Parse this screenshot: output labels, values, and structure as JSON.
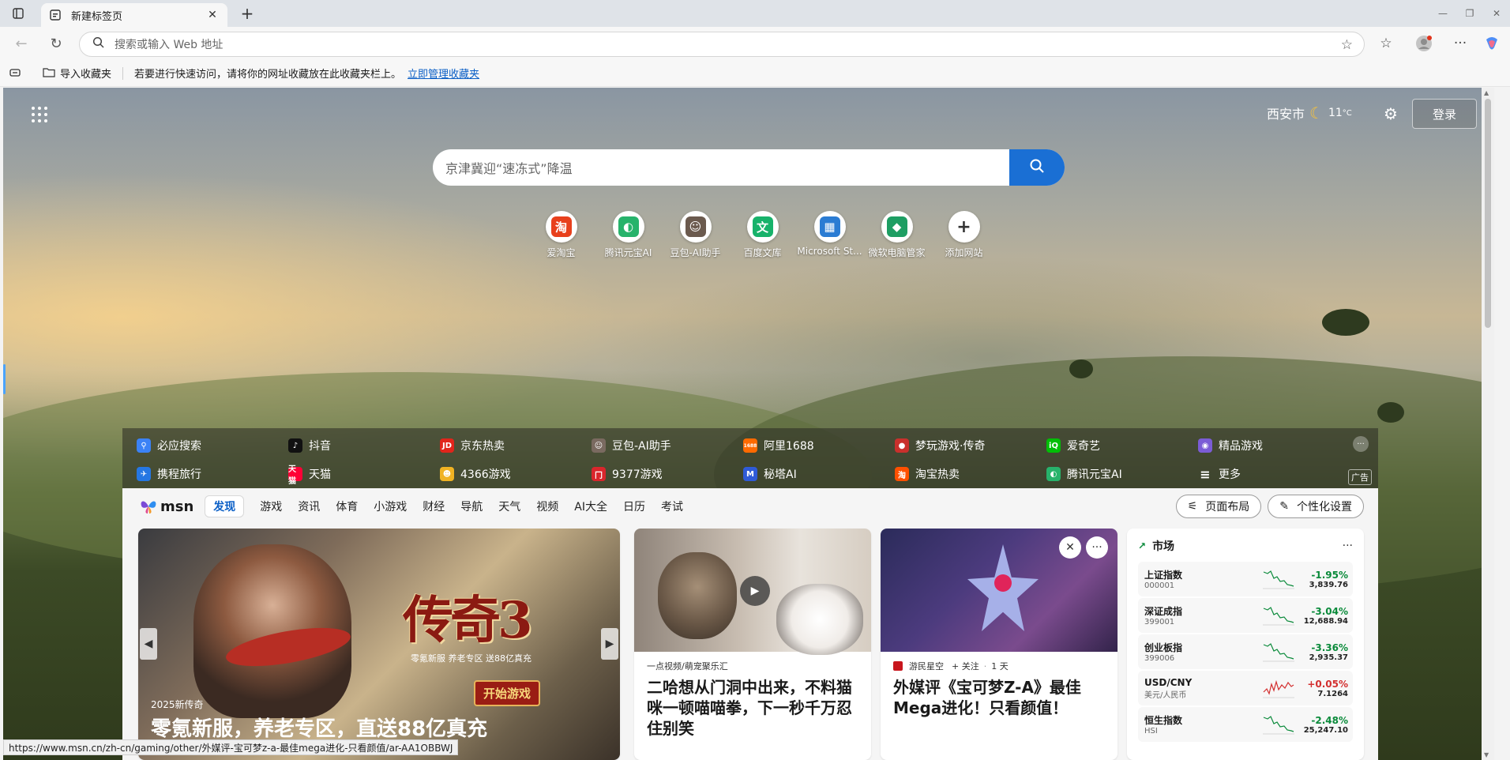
{
  "browser": {
    "tab_title": "新建标签页",
    "address_placeholder": "搜索或输入 Web 地址"
  },
  "favorites_bar": {
    "import_label": "导入收藏夹",
    "hint": "若要进行快速访问，请将你的网址收藏放在此收藏夹栏上。",
    "manage_link": "立即管理收藏夹"
  },
  "header": {
    "city": "西安市",
    "temperature": "11",
    "temp_unit": "°C",
    "login_label": "登录"
  },
  "search": {
    "placeholder": "京津冀迎“速冻式”降温"
  },
  "tiles": [
    {
      "label": "爱淘宝",
      "icon": "taobao-icon",
      "glyph": "淘",
      "color": "#e8401c"
    },
    {
      "label": "腾讯元宝AI",
      "icon": "yuanbao-icon",
      "glyph": "◐",
      "color": "#27b36b"
    },
    {
      "label": "豆包-AI助手",
      "icon": "doubao-icon",
      "glyph": "☺",
      "color": "#6b5a4e"
    },
    {
      "label": "百度文库",
      "icon": "wenku-icon",
      "glyph": "文",
      "color": "#17b26a"
    },
    {
      "label": "Microsoft St...",
      "icon": "microsoft-store-icon",
      "glyph": "▦",
      "color": "#2b7cd3"
    },
    {
      "label": "微软电脑管家",
      "icon": "pc-manager-icon",
      "glyph": "◆",
      "color": "#1e9e63"
    },
    {
      "label": "添加网站",
      "icon": "add-site-icon",
      "glyph": "+",
      "color": "#ffffff"
    }
  ],
  "quick_links": {
    "row1": [
      {
        "label": "必应搜索",
        "icon": "bing-search-icon",
        "glyph": "⚲",
        "color": "#3b82f6"
      },
      {
        "label": "抖音",
        "icon": "douyin-icon",
        "glyph": "♪",
        "color": "#111111"
      },
      {
        "label": "京东热卖",
        "icon": "jd-icon",
        "glyph": "JD",
        "color": "#e1251b"
      },
      {
        "label": "豆包-AI助手",
        "icon": "doubao-icon",
        "glyph": "☺",
        "color": "#7a6a60"
      },
      {
        "label": "阿里1688",
        "icon": "ali1688-icon",
        "glyph": "1688",
        "color": "#ff6a00"
      },
      {
        "label": "梦玩游戏·传奇",
        "icon": "mengwan-icon",
        "glyph": "●",
        "color": "#c9302c"
      },
      {
        "label": "爱奇艺",
        "icon": "iqiyi-icon",
        "glyph": "iQ",
        "color": "#00be06"
      },
      {
        "label": "精品游戏",
        "icon": "gamepad-icon",
        "glyph": "◉",
        "color": "#7b5cd6"
      }
    ],
    "row2": [
      {
        "label": "携程旅行",
        "icon": "ctrip-icon",
        "glyph": "✈",
        "color": "#2577e3"
      },
      {
        "label": "天猫",
        "icon": "tmall-icon",
        "glyph": "天猫",
        "color": "#ff0036"
      },
      {
        "label": "4366游戏",
        "icon": "game4366-icon",
        "glyph": "☻",
        "color": "#f0b323"
      },
      {
        "label": "9377游戏",
        "icon": "game9377-icon",
        "glyph": "冂",
        "color": "#d9262c"
      },
      {
        "label": "秘塔AI",
        "icon": "metaso-icon",
        "glyph": "M",
        "color": "#2f5bd8"
      },
      {
        "label": "淘宝热卖",
        "icon": "taobao-hot-icon",
        "glyph": "淘",
        "color": "#ff5000"
      },
      {
        "label": "腾讯元宝AI",
        "icon": "yuanbao-icon",
        "glyph": "◐",
        "color": "#27b36b"
      },
      {
        "label": "更多",
        "icon": "menu-icon",
        "glyph": "≡",
        "color": "transparent"
      }
    ],
    "ad_label": "广告"
  },
  "feed": {
    "brand": "msn",
    "tabs": [
      "发现",
      "游戏",
      "资讯",
      "体育",
      "小游戏",
      "财经",
      "导航",
      "天气",
      "视频",
      "AI大全",
      "日历",
      "考试"
    ],
    "layout_label": "页面布局",
    "personalize_label": "个性化设置"
  },
  "hero_card": {
    "game_logo": "传奇3",
    "game_sub": "零氪新服  养老专区  送88亿真充",
    "play_label": "开始游戏",
    "kicker": "2025新传奇",
    "headline": "零氪新服，养老专区，直送88亿真充"
  },
  "news_cards": [
    {
      "source": "一点视频/萌宠聚乐汇",
      "title": "二哈想从门洞中出来，不料猫咪一顿喵喵拳，下一秒千万忍住别笑"
    },
    {
      "source": "游民星空",
      "follow": "+ 关注",
      "time": "1 天",
      "title": "外媒评《宝可梦Z-A》最佳Mega进化！只看颜值！"
    }
  ],
  "market": {
    "title": "市场",
    "rows": [
      {
        "name": "上证指数",
        "code": "000001",
        "change": "-1.95%",
        "value": "3,839.76",
        "dir": "neg"
      },
      {
        "name": "深证成指",
        "code": "399001",
        "change": "-3.04%",
        "value": "12,688.94",
        "dir": "neg"
      },
      {
        "name": "创业板指",
        "code": "399006",
        "change": "-3.36%",
        "value": "2,935.37",
        "dir": "neg"
      },
      {
        "name": "USD/CNY",
        "code": "美元/人民币",
        "change": "+0.05%",
        "value": "7.1264",
        "dir": "pos"
      },
      {
        "name": "恒生指数",
        "code": "HSI",
        "change": "-2.48%",
        "value": "25,247.10",
        "dir": "neg"
      }
    ]
  },
  "status_url": "https://www.msn.cn/zh-cn/gaming/other/外媒评-宝可梦z-a-最佳mega进化-只看颜值/ar-AA1OBBWJ"
}
